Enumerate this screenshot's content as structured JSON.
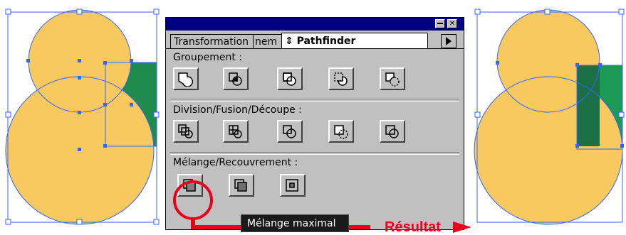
{
  "colors": {
    "shape_fill": "#f7c95e",
    "green_fill": "#1f8b4c",
    "dark_green": "#1a6f45",
    "selection": "#3366ff",
    "palette_bg": "#c0c0c0",
    "titlebar": "#000080",
    "highlight": "#e8001c"
  },
  "palette": {
    "tabs": {
      "transformation": "Transformation",
      "alignement": "nem",
      "pathfinder": "⇕ Pathfinder"
    },
    "sections": {
      "groupement": "Groupement :",
      "division": "Division/Fusion/Découpe :",
      "melange": "Mélange/Recouvrement :"
    },
    "icons": {
      "groupement": [
        "unite-icon",
        "intersection-icon",
        "exclusion-icon",
        "soustraction-icon",
        "soustraction-arriere-icon"
      ],
      "division": [
        "division-icon",
        "detourage-icon",
        "fusion-icon",
        "recadrer-icon",
        "contour-icon"
      ],
      "melange": [
        "melange-maximal-icon",
        "melange-icon",
        "recouvrement-icon"
      ]
    }
  },
  "tooltip": "Mélange maximal",
  "result_label": "Résultat"
}
